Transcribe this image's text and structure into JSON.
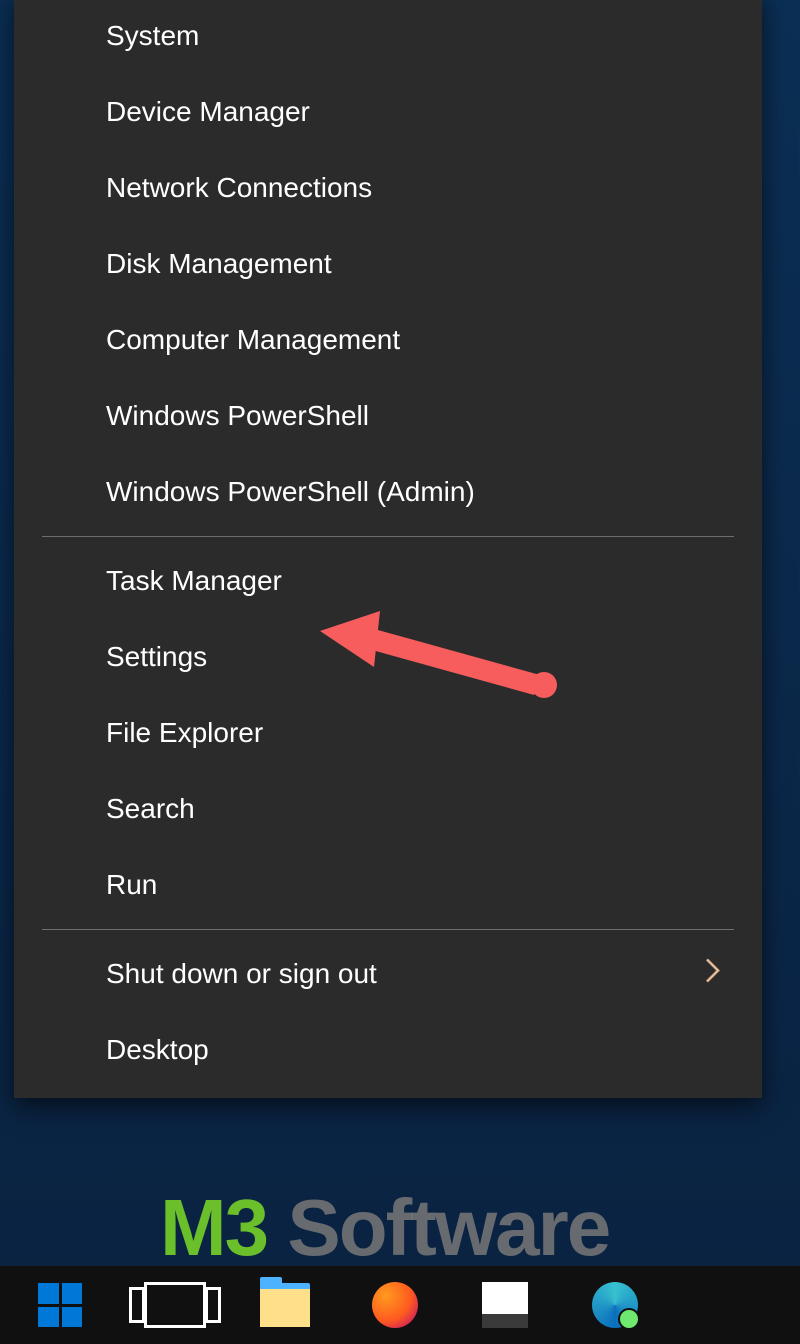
{
  "menu": {
    "group1": [
      "System",
      "Device Manager",
      "Network Connections",
      "Disk Management",
      "Computer Management",
      "Windows PowerShell",
      "Windows PowerShell (Admin)"
    ],
    "group2": [
      "Task Manager",
      "Settings",
      "File Explorer",
      "Search",
      "Run"
    ],
    "group3": {
      "shutdown": "Shut down or sign out",
      "desktop": "Desktop"
    }
  },
  "annotation": {
    "target": "Task Manager",
    "arrow_color": "#f85d5d"
  },
  "watermark": {
    "brand": "M3",
    "rest": " Software"
  },
  "taskbar": {
    "icons": [
      "start",
      "task-view",
      "file-explorer",
      "firefox",
      "app",
      "edge"
    ]
  }
}
